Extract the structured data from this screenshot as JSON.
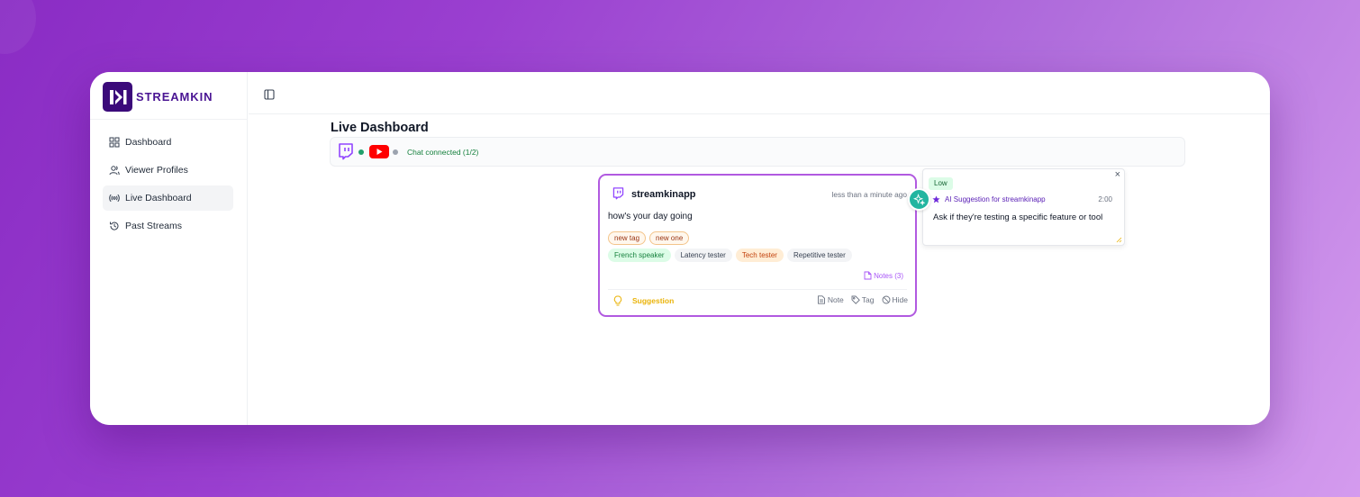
{
  "brand": {
    "name": "STREAMKIN"
  },
  "sidebar": {
    "items": [
      {
        "label": "Dashboard",
        "icon": "grid-icon"
      },
      {
        "label": "Viewer Profiles",
        "icon": "users-icon"
      },
      {
        "label": "Live Dashboard",
        "icon": "broadcast-icon",
        "active": true
      },
      {
        "label": "Past Streams",
        "icon": "history-icon"
      }
    ]
  },
  "header": {
    "toggle_icon": "sidebar-toggle-icon"
  },
  "main": {
    "title": "Live Dashboard",
    "status": {
      "text": "Chat connected (1/2)",
      "twitch_dot": "#22a06b",
      "youtube_dot": "#9ca3af"
    }
  },
  "message": {
    "username": "streamkinapp",
    "time": "less than a minute ago",
    "text": "how's your day going",
    "tags": [
      "new tag",
      "new one"
    ],
    "labels": [
      {
        "text": "French speaker",
        "style": "green"
      },
      {
        "text": "Latency tester",
        "style": "gray"
      },
      {
        "text": "Tech tester",
        "style": "orange"
      },
      {
        "text": "Repetitive tester",
        "style": "gray"
      }
    ],
    "notes_label": "Notes (3)",
    "suggestion_label": "Suggestion",
    "actions": {
      "note": "Note",
      "tag": "Tag",
      "hide": "Hide"
    }
  },
  "ai_suggestion": {
    "priority": "Low",
    "title": "AI Suggestion for streamkinapp",
    "timer": "2:00",
    "text": "Ask if they're testing a specific feature or tool",
    "close": "×"
  },
  "colors": {
    "brand": "#3b0a7a",
    "card_border": "#b15ae0",
    "ai_bubble": "#22b5a0",
    "twitch": "#9146ff",
    "youtube": "#ff0000"
  }
}
